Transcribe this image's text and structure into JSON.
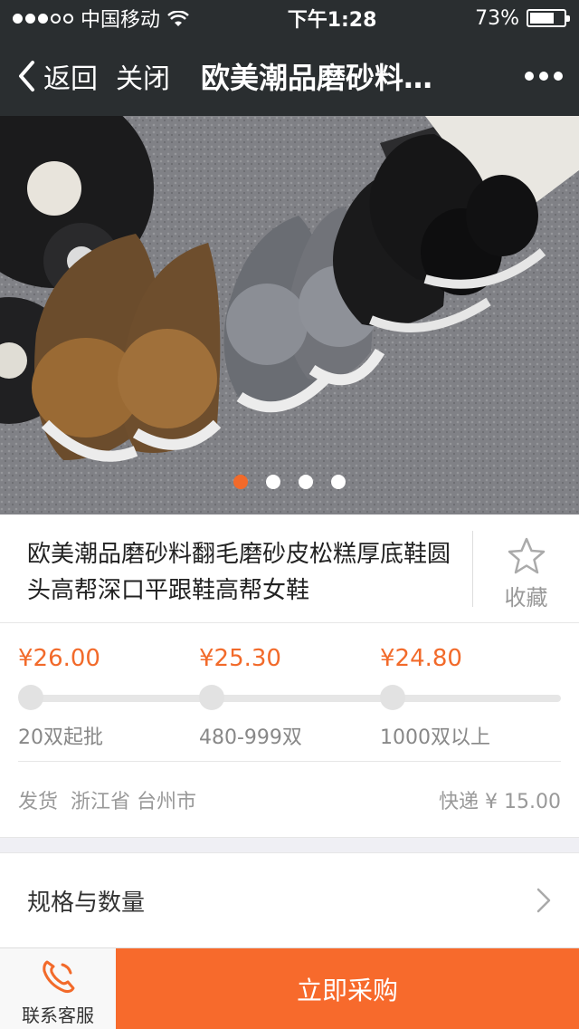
{
  "status_bar": {
    "carrier": "中国移动",
    "time": "下午1:28",
    "battery": "73%",
    "battery_level": 0.73
  },
  "nav": {
    "back_label": "返回",
    "close_label": "关闭",
    "title": "欧美潮品磨砂料…",
    "more_icon": "more-dots-icon"
  },
  "gallery": {
    "image_count": 4,
    "active_index": 0,
    "accent_color": "#f26a2a"
  },
  "product": {
    "title": "欧美潮品磨砂料翻毛磨砂皮松糕厚底鞋圆头高帮深口平跟鞋高帮女鞋",
    "favorite_label": "收藏"
  },
  "price_tiers": [
    {
      "price": "¥26.00",
      "quantity": "20双起批"
    },
    {
      "price": "¥25.30",
      "quantity": "480-999双"
    },
    {
      "price": "¥24.80",
      "quantity": "1000双以上"
    }
  ],
  "shipping": {
    "origin": "发货  浙江省 台州市",
    "fee": "快递 ¥ 15.00"
  },
  "spec": {
    "label": "规格与数量"
  },
  "bottom": {
    "service_label": "联系客服",
    "buy_label": "立即采购"
  },
  "colors": {
    "nav_bg": "#2a2e30",
    "price_orange": "#f26a2a",
    "buy_button": "#f76a2c"
  }
}
